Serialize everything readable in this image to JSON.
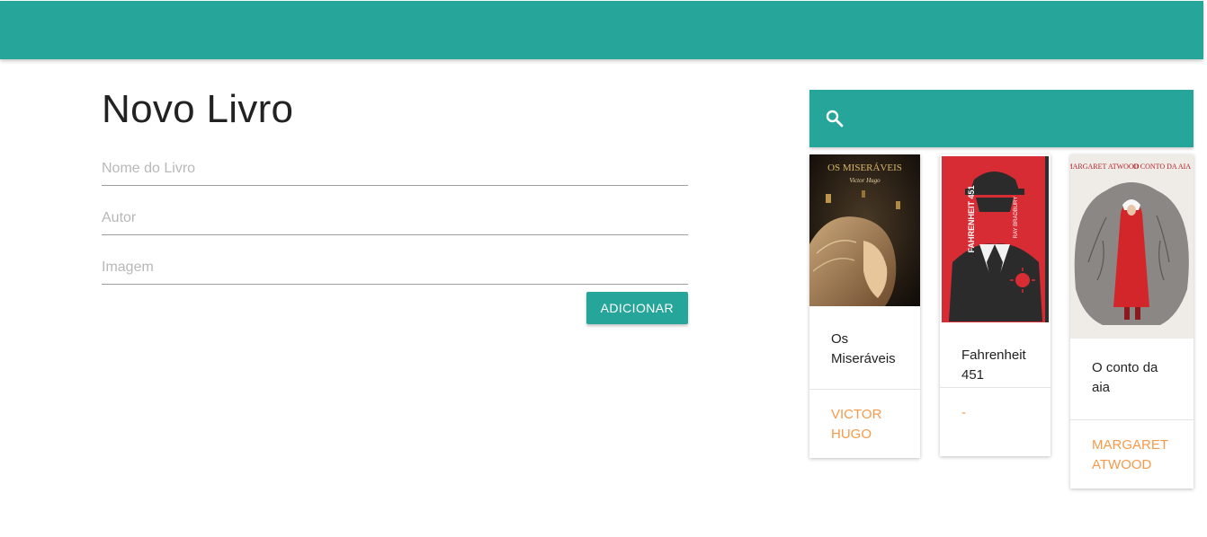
{
  "form": {
    "title": "Novo Livro",
    "name_placeholder": "Nome do Livro",
    "author_placeholder": "Autor",
    "image_placeholder": "Imagem",
    "name_value": "",
    "author_value": "",
    "image_value": "",
    "add_label": "ADICIONAR"
  },
  "search": {
    "icon": "search-icon",
    "value": ""
  },
  "books": [
    {
      "title": "Os Miseráveis",
      "author": "VICTOR HUGO",
      "cover_text": "OS MISERÁVEIS",
      "cover_subtext": "Victor Hugo"
    },
    {
      "title": "Fahrenheit 451",
      "author": "-",
      "cover_text": "FAHRENHEIT 451",
      "cover_subtext": "RAY BRADBURY"
    },
    {
      "title": "O conto da aia",
      "author": "MARGARET ATWOOD",
      "cover_text": "MARGARET ATWOOD",
      "cover_subtext": "O CONTO DA AIA"
    }
  ],
  "colors": {
    "primary": "#26a69a",
    "accent": "#f59a4a"
  }
}
